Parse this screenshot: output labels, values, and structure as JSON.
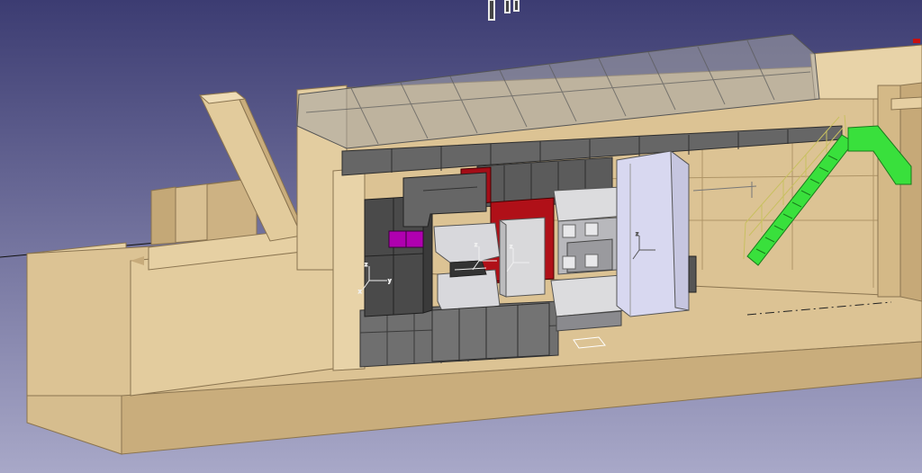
{
  "viewport": {
    "background_top": "#3c3c72",
    "background_bottom": "#a8a8c8",
    "palette": {
      "sand": "#dcc394",
      "sand_light": "#e8d3a8",
      "sand_dark": "#c2a676",
      "concrete": "#6f6f6f",
      "concrete_dark": "#4a4a4a",
      "concrete_light": "#8e8e8e",
      "red_block": "#a80a14",
      "magenta": "#b000b0",
      "light_grey": "#d8d8dc",
      "lavender": "#d8d8f0",
      "green_stair": "#39e03c",
      "glass": "#9a9a9a",
      "rail_yellow": "#c8c060"
    }
  },
  "compass": {
    "icon": "compass-icon"
  },
  "axes": {
    "icon": "axis-triad-icon",
    "x_label": "x",
    "y_label": "y",
    "z_label": "z"
  }
}
